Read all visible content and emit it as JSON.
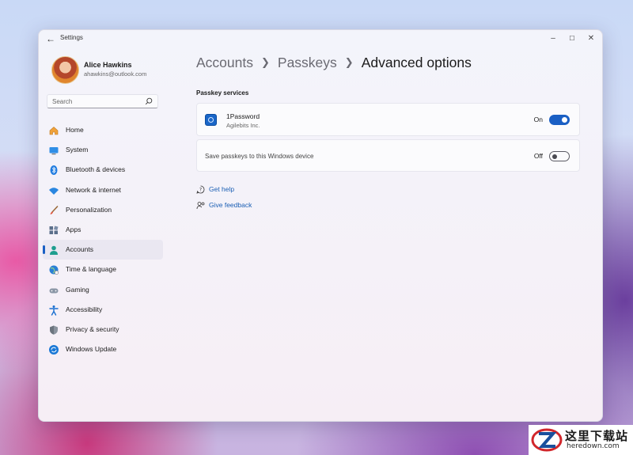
{
  "window": {
    "title": "Settings"
  },
  "user": {
    "name": "Alice Hawkins",
    "email": "ahawkins@outlook.com"
  },
  "search": {
    "placeholder": "Search"
  },
  "nav": {
    "items": [
      {
        "label": "Home",
        "icon": "home-icon"
      },
      {
        "label": "System",
        "icon": "system-icon"
      },
      {
        "label": "Bluetooth & devices",
        "icon": "bluetooth-icon"
      },
      {
        "label": "Network & internet",
        "icon": "wifi-icon"
      },
      {
        "label": "Personalization",
        "icon": "brush-icon"
      },
      {
        "label": "Apps",
        "icon": "apps-icon"
      },
      {
        "label": "Accounts",
        "icon": "person-icon",
        "selected": true
      },
      {
        "label": "Time & language",
        "icon": "globe-clock-icon"
      },
      {
        "label": "Gaming",
        "icon": "gamepad-icon"
      },
      {
        "label": "Accessibility",
        "icon": "accessibility-icon"
      },
      {
        "label": "Privacy & security",
        "icon": "shield-icon"
      },
      {
        "label": "Windows Update",
        "icon": "update-icon"
      }
    ]
  },
  "breadcrumb": {
    "level1": "Accounts",
    "level2": "Passkeys",
    "current": "Advanced options"
  },
  "passkey": {
    "section_title": "Passkey services",
    "service": {
      "name": "1Password",
      "publisher": "Agilebits Inc.",
      "state_label": "On",
      "enabled": true
    },
    "local": {
      "label": "Save passkeys to this Windows device",
      "state_label": "Off",
      "enabled": false
    }
  },
  "links": {
    "help": "Get help",
    "feedback": "Give feedback"
  },
  "colors": {
    "accent": "#1a5fc4",
    "link": "#1a5fb4"
  },
  "watermark": {
    "cn": "这里下载站",
    "en": "heredown.com"
  }
}
